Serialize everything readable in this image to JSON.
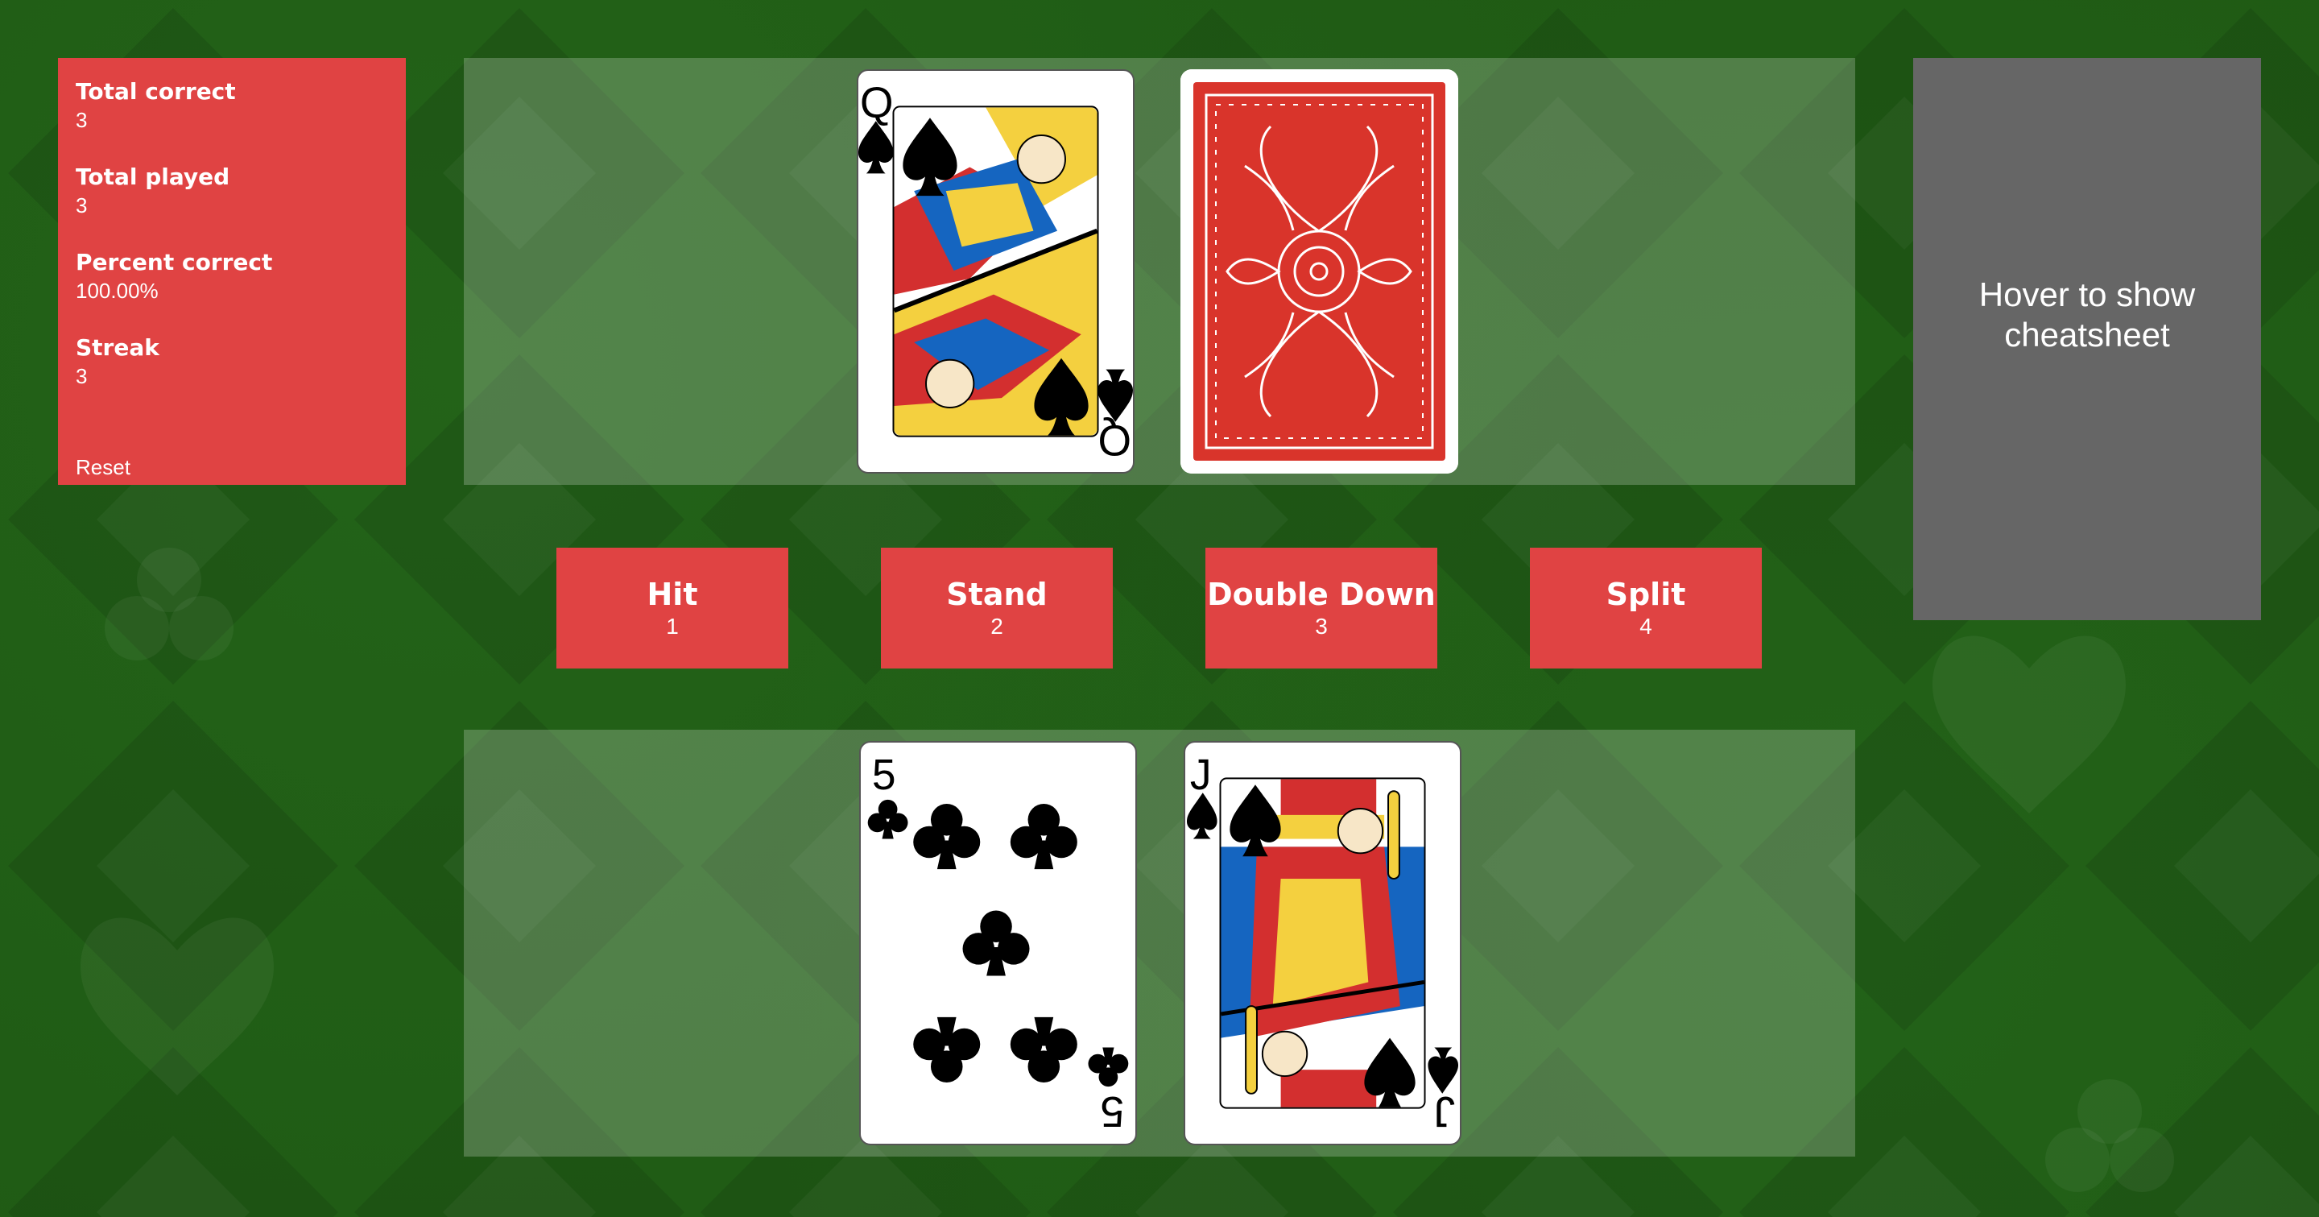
{
  "stats": {
    "total_correct_label": "Total correct",
    "total_correct_value": "3",
    "total_played_label": "Total played",
    "total_played_value": "3",
    "percent_correct_label": "Percent correct",
    "percent_correct_value": "100.00%",
    "streak_label": "Streak",
    "streak_value": "3",
    "reset_label": "Reset"
  },
  "dealer": {
    "cards": [
      {
        "rank": "Q",
        "suit": "spades",
        "face_up": true
      },
      {
        "rank": "",
        "suit": "",
        "face_up": false
      }
    ]
  },
  "player": {
    "cards": [
      {
        "rank": "5",
        "suit": "clubs",
        "face_up": true
      },
      {
        "rank": "J",
        "suit": "spades",
        "face_up": true
      }
    ]
  },
  "actions": [
    {
      "label": "Hit",
      "key": "1"
    },
    {
      "label": "Stand",
      "key": "2"
    },
    {
      "label": "Double Down",
      "key": "3"
    },
    {
      "label": "Split",
      "key": "4"
    }
  ],
  "cheatsheet": {
    "label": "Hover to show cheatsheet"
  },
  "colors": {
    "felt": "#1f5a14",
    "panel_red": "#e04343",
    "cheatsheet_gray": "#666666",
    "card_back_red": "#d9342b"
  }
}
